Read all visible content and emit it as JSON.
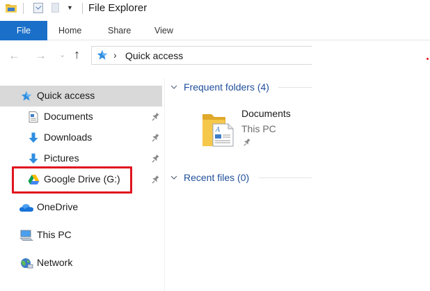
{
  "window": {
    "title": "File Explorer"
  },
  "ribbon": {
    "tabs": [
      "File",
      "Home",
      "Share",
      "View"
    ]
  },
  "address": {
    "location": "Quick access"
  },
  "nav_pane": {
    "items": [
      {
        "label": "Quick access",
        "icon": "star-icon"
      },
      {
        "label": "Documents",
        "icon": "documents-icon",
        "pinned": true
      },
      {
        "label": "Downloads",
        "icon": "download-arrow-icon",
        "pinned": true
      },
      {
        "label": "Pictures",
        "icon": "pictures-arrow-icon",
        "pinned": true
      },
      {
        "label": "Google Drive (G:)",
        "icon": "google-drive-icon",
        "pinned": true
      },
      {
        "label": "OneDrive",
        "icon": "cloud-icon"
      },
      {
        "label": "This PC",
        "icon": "computer-icon"
      },
      {
        "label": "Network",
        "icon": "network-icon"
      }
    ]
  },
  "content": {
    "frequent_header": "Frequent folders (4)",
    "recent_header": "Recent files (0)",
    "frequent_folders": [
      {
        "name": "Documents",
        "location": "This PC"
      }
    ]
  },
  "colors": {
    "file_tab": "#1a6fc9",
    "group_header": "#1f4e9a",
    "selection": "#d9d9d9",
    "annotation_red": "#e0141e"
  }
}
